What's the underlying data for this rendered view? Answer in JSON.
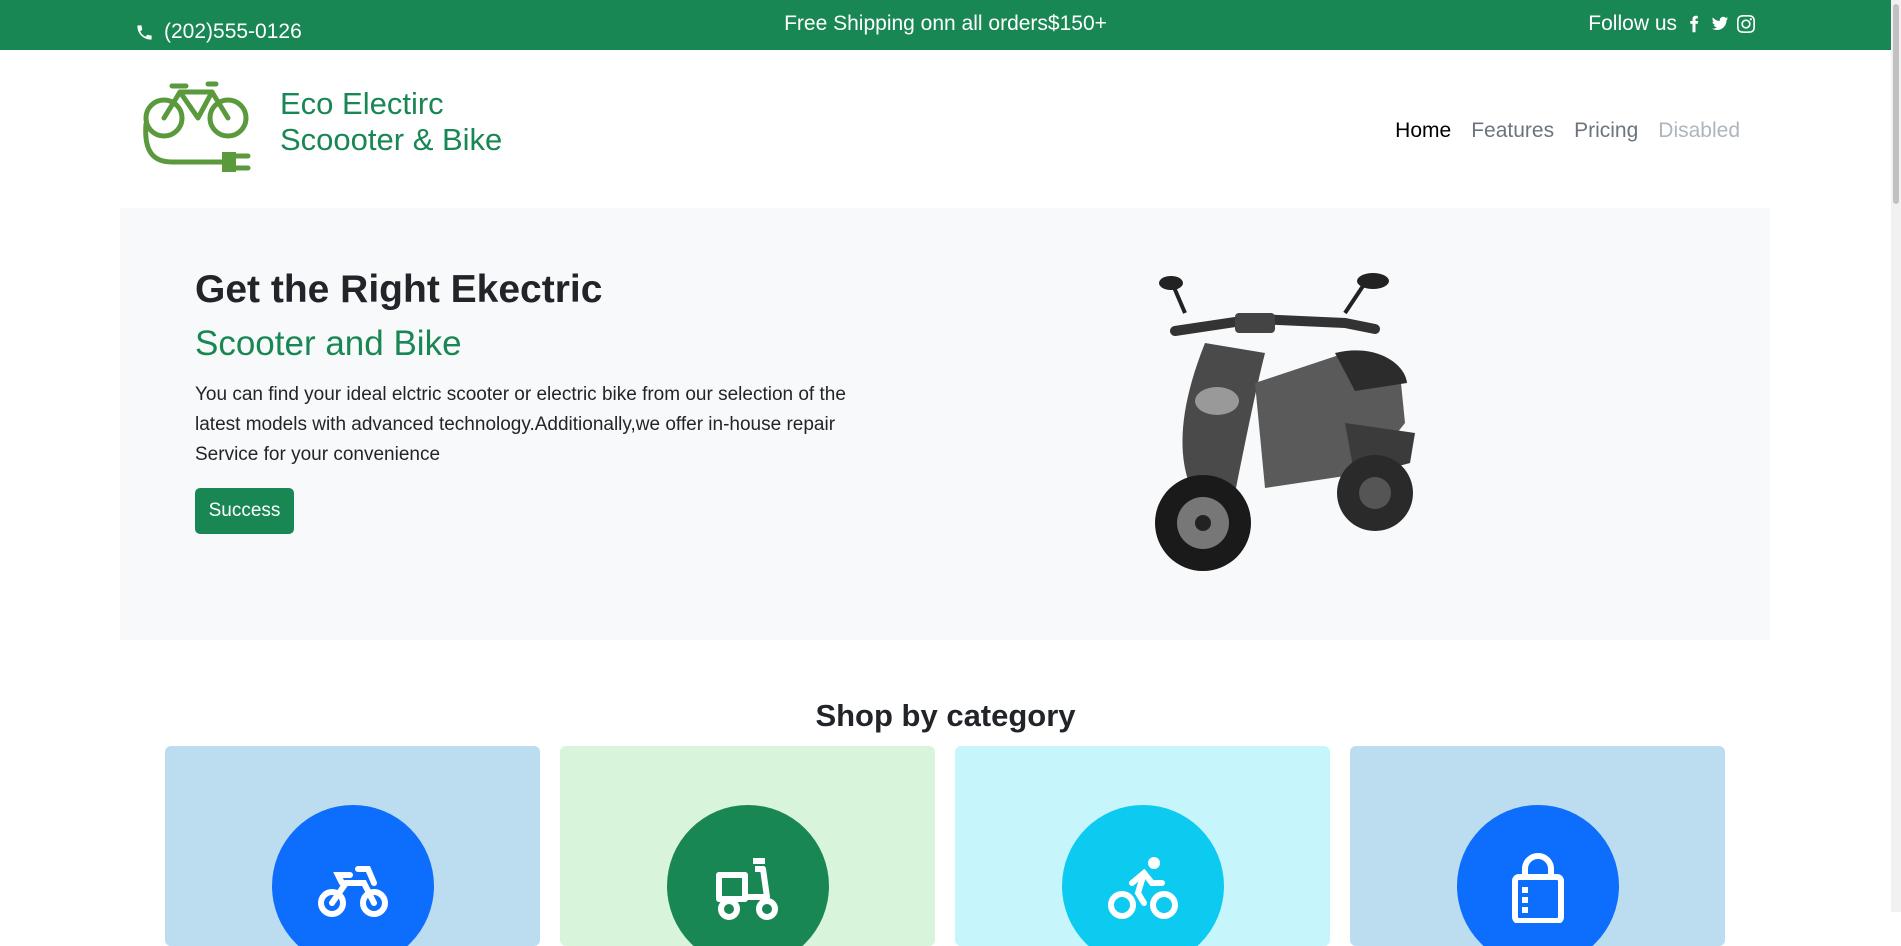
{
  "topbar": {
    "phone": "(202)555-0126",
    "promo": "Free Shipping onn all orders$150+",
    "follow_label": "Follow us",
    "social_icons": [
      "facebook-icon",
      "twitter-icon",
      "instagram-icon"
    ]
  },
  "brand": {
    "line1": "Eco Electirc",
    "line2": "Scoooter & Bike"
  },
  "nav": {
    "items": [
      {
        "label": "Home",
        "state": "active"
      },
      {
        "label": "Features",
        "state": "normal"
      },
      {
        "label": "Pricing",
        "state": "normal"
      },
      {
        "label": "Disabled",
        "state": "disabled"
      }
    ]
  },
  "hero": {
    "title": "Get the Right Ekectric",
    "subtitle": "Scooter and Bike",
    "description": "You can find your ideal elctric scooter or electric bike from our selection of the latest models with advanced technology.Additionally,we offer in-house repair Service for your convenience",
    "button_label": "Success"
  },
  "categories": {
    "title": "Shop by category",
    "cards": [
      {
        "icon": "motorcycle-icon",
        "card_bg": "#bcdcf0",
        "circle": "#0d6efd"
      },
      {
        "icon": "delivery-scooter-icon",
        "card_bg": "#d8f5dc",
        "circle": "#198754"
      },
      {
        "icon": "cyclist-icon",
        "card_bg": "#c6f6fb",
        "circle": "#0dcaf0"
      },
      {
        "icon": "shopping-bag-icon",
        "card_bg": "#bcdcf0",
        "circle": "#0d6efd"
      }
    ]
  },
  "colors": {
    "brand_green": "#198754",
    "hero_bg": "#f8f9fa"
  }
}
